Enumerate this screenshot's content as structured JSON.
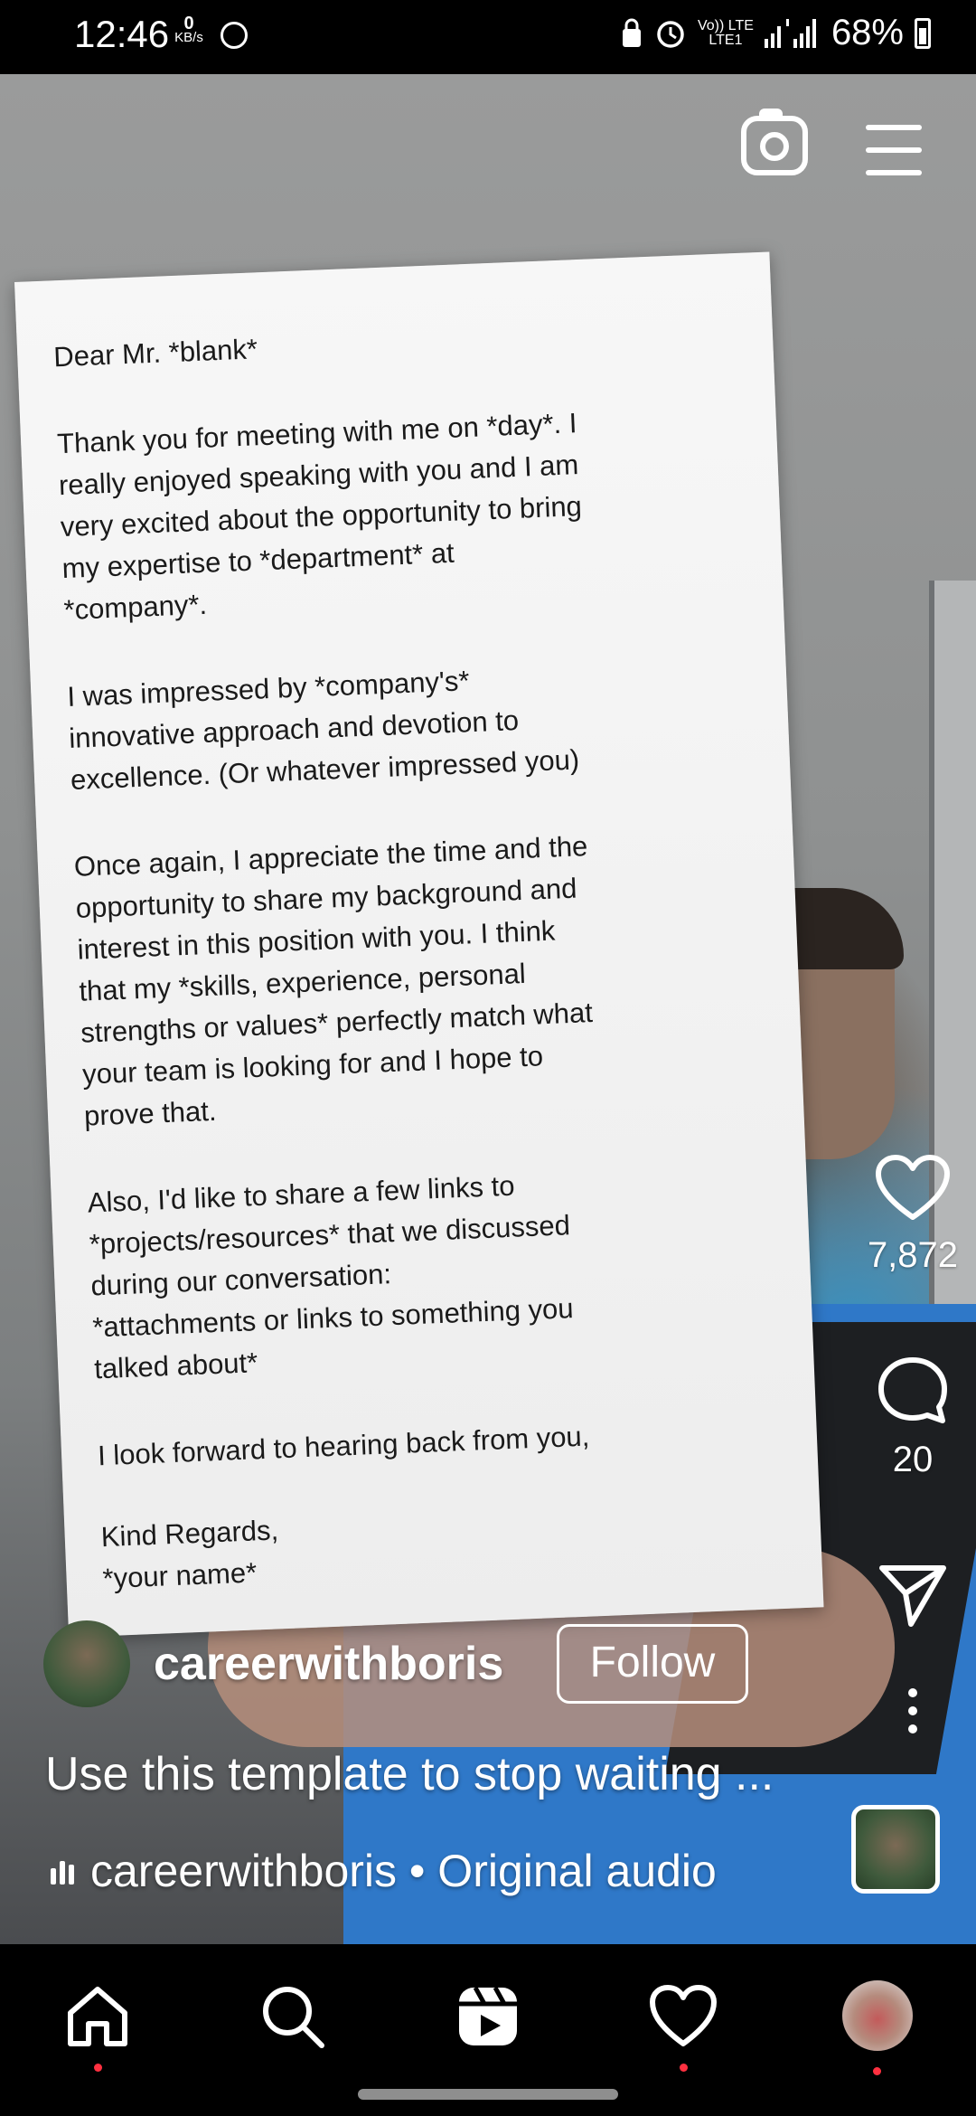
{
  "status_bar": {
    "time": "12:46",
    "net_speed": "0",
    "net_unit": "KB/s",
    "network_label": "Vo)) LTE",
    "network_sub": "LTE1",
    "battery": "68%"
  },
  "letter": {
    "paragraphs": [
      "Dear Mr. *blank*",
      "Thank you for meeting with me on *day*. I\nreally enjoyed speaking with you and I am\nvery excited about the opportunity to bring\nmy expertise to *department* at\n*company*.",
      "I was impressed by *company's*\ninnovative approach and devotion to\nexcellence. (Or whatever impressed you)",
      "Once again, I appreciate the time and the\nopportunity to share my background and\ninterest in this position with you. I think\nthat my *skills, experience, personal\nstrengths or values* perfectly match what\nyour team is looking for and I hope to\nprove that.",
      "Also, I'd like to share a few links to\n*projects/resources* that we discussed\nduring our conversation:\n*attachments or links to something you\ntalked about*",
      "I look forward to hearing back from you,",
      "Kind Regards,\n*your name*"
    ]
  },
  "actions": {
    "likes": "7,872",
    "comments": "20"
  },
  "post": {
    "username": "careerwithboris",
    "follow_label": "Follow",
    "caption": "Use this template to stop waiting ...",
    "audio": "careerwithboris • Original audio"
  },
  "icons": {
    "camera": "camera-icon",
    "menu": "menu-icon",
    "like": "heart-icon",
    "comment": "comment-icon",
    "share": "send-icon",
    "more": "more-vertical-icon",
    "nav": [
      "home-icon",
      "search-icon",
      "reels-icon",
      "heart-icon",
      "profile-avatar"
    ]
  },
  "colors": {
    "notification_dot": "#ff3040",
    "background": "#000000"
  }
}
